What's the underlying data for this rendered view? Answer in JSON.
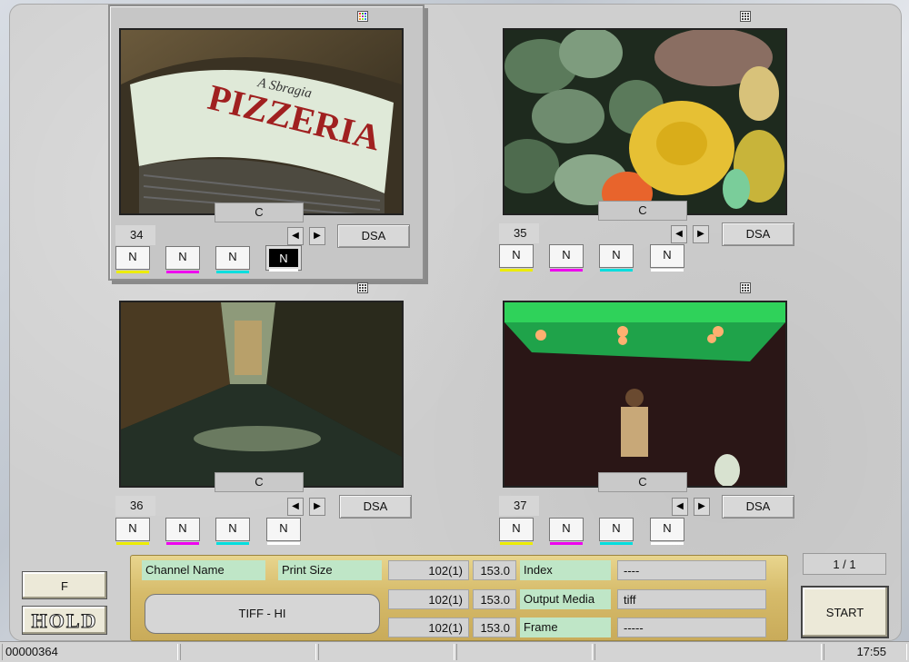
{
  "frames": [
    {
      "number": "34",
      "channel": "C",
      "dsa": "DSA",
      "n": [
        "N",
        "N",
        "N",
        "N"
      ],
      "selected": true
    },
    {
      "number": "35",
      "channel": "C",
      "dsa": "DSA",
      "n": [
        "N",
        "N",
        "N",
        "N"
      ],
      "selected": false
    },
    {
      "number": "36",
      "channel": "C",
      "dsa": "DSA",
      "n": [
        "N",
        "N",
        "N",
        "N"
      ],
      "selected": false
    },
    {
      "number": "37",
      "channel": "C",
      "dsa": "DSA",
      "n": [
        "N",
        "N",
        "N",
        "N"
      ],
      "selected": false
    }
  ],
  "photos": {
    "pizzeria_sign": "PIZZERIA",
    "pizzeria_small": "A Sbragia"
  },
  "info": {
    "channel_name_label": "Channel Name",
    "print_size_label": "Print Size",
    "channel_value": "TIFF - HI",
    "rows": [
      {
        "size_a": "102(1)",
        "size_b": "153.0",
        "label": "Index",
        "value": "----"
      },
      {
        "size_a": "102(1)",
        "size_b": "153.0",
        "label": "Output Media",
        "value": "tiff"
      },
      {
        "size_a": "102(1)",
        "size_b": "153.0",
        "label": "Frame",
        "value": "-----"
      }
    ]
  },
  "controls": {
    "f_label": "F",
    "hold_label": "HOLD",
    "page_indicator": "1 / 1",
    "start_label": "START"
  },
  "status": {
    "counter": "00000364",
    "time": "17:55"
  },
  "colors": {
    "yellow": "#ecec00",
    "magenta": "#ee00ee",
    "cyan": "#00dede",
    "gold": "#d6bb6a",
    "green_label": "#bfe6c7"
  }
}
